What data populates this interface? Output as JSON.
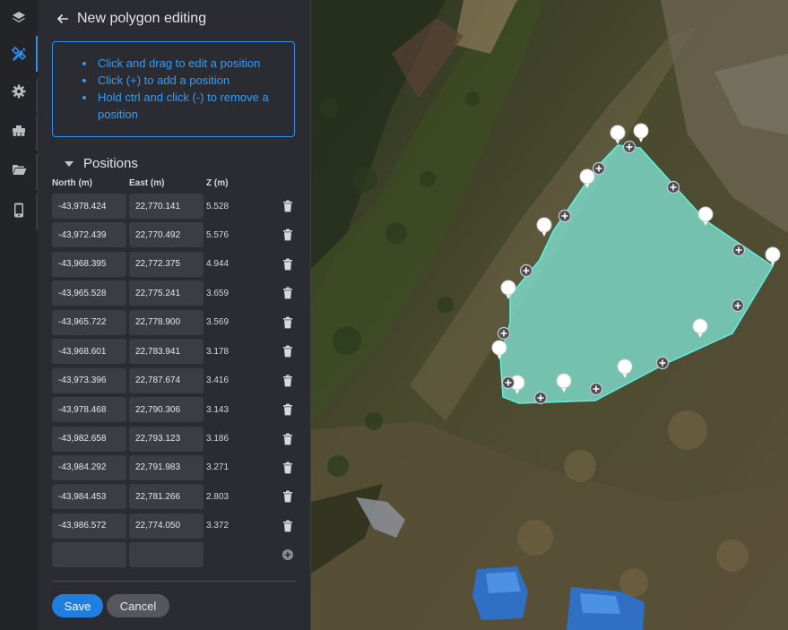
{
  "rail": {
    "items": [
      {
        "name": "layers-icon",
        "active": false
      },
      {
        "name": "edit-tools-icon",
        "active": true
      },
      {
        "name": "settings-gear-icon",
        "active": false
      },
      {
        "name": "vehicle-icon",
        "active": false
      },
      {
        "name": "folder-icon",
        "active": false
      },
      {
        "name": "mobile-device-icon",
        "active": false
      }
    ]
  },
  "panel": {
    "title": "New polygon editing",
    "instructions": [
      "Click and drag to edit a position",
      "Click (+) to add a position",
      "Hold ctrl and click (-) to remove a position"
    ],
    "section_title": "Positions",
    "columns": {
      "north": "North (m)",
      "east": "East (m)",
      "z": "Z (m)"
    },
    "positions": [
      {
        "north": "-43,978.424",
        "east": "22,770.141",
        "z": "5.528"
      },
      {
        "north": "-43,972.439",
        "east": "22,770.492",
        "z": "5.576"
      },
      {
        "north": "-43,968.395",
        "east": "22,772.375",
        "z": "4.944"
      },
      {
        "north": "-43,965.528",
        "east": "22,775.241",
        "z": "3.659"
      },
      {
        "north": "-43,965.722",
        "east": "22,778.900",
        "z": "3.569"
      },
      {
        "north": "-43,968.601",
        "east": "22,783.941",
        "z": "3.178"
      },
      {
        "north": "-43,973.396",
        "east": "22,787.674",
        "z": "3.416"
      },
      {
        "north": "-43,978.468",
        "east": "22,790.306",
        "z": "3.143"
      },
      {
        "north": "-43,982.658",
        "east": "22,793.123",
        "z": "3.186"
      },
      {
        "north": "-43,984.292",
        "east": "22,791.983",
        "z": "3.271"
      },
      {
        "north": "-43,984.453",
        "east": "22,781.266",
        "z": "2.803"
      },
      {
        "north": "-43,986.572",
        "east": "22,774.050",
        "z": "3.372"
      }
    ],
    "new_row": {
      "north": "",
      "east": ""
    },
    "save_label": "Save",
    "cancel_label": "Cancel"
  },
  "colors": {
    "accent": "#2f8fea",
    "panel_bg": "#2a2c31",
    "polygon_fill": "#7fe3d2",
    "polygon_stroke": "#5ff0dc"
  }
}
